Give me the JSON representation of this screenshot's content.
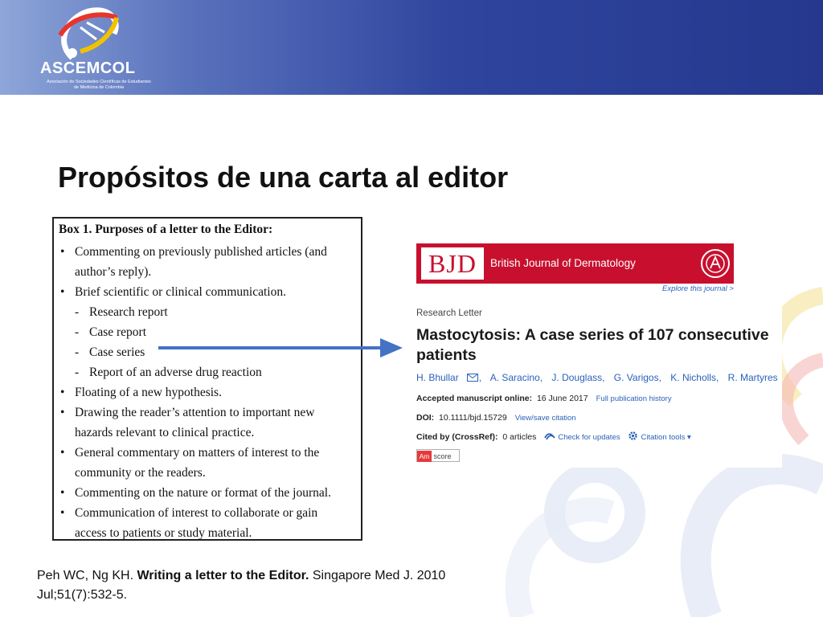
{
  "logo": {
    "name": "ASCEMCOL",
    "subtitle": "Asociación de Sociedades Científicas de Estudiantes de Medicina de Colombia",
    "icon": "dna-helix-logo"
  },
  "colors": {
    "header_start": "#8ea6d8",
    "header_end": "#25388e",
    "bjd_red": "#c8102e",
    "link_blue": "#2a62b8",
    "arrow_blue": "#4472c4"
  },
  "slide": {
    "title": "Propósitos de una carta al editor"
  },
  "box": {
    "title": "Box 1. Purposes of a letter to the Editor:",
    "rows": [
      {
        "marker": "•",
        "text": "Commenting on previously published articles (and",
        "sub": false
      },
      {
        "marker": "",
        "text": "author’s reply).",
        "sub": false
      },
      {
        "marker": "•",
        "text": "Brief scientific or clinical communication.",
        "sub": false
      },
      {
        "marker": "-",
        "text": "Research report",
        "sub": true
      },
      {
        "marker": "-",
        "text": "Case report",
        "sub": true
      },
      {
        "marker": "-",
        "text": "Case series",
        "sub": true
      },
      {
        "marker": "-",
        "text": "Report of an adverse drug reaction",
        "sub": true
      },
      {
        "marker": "•",
        "text": "Floating of a new hypothesis.",
        "sub": false
      },
      {
        "marker": "•",
        "text": "Drawing the reader’s attention to important new",
        "sub": false
      },
      {
        "marker": "",
        "text": "hazards relevant to clinical practice.",
        "sub": false
      },
      {
        "marker": "•",
        "text": "General commentary on matters of interest to the",
        "sub": false
      },
      {
        "marker": "",
        "text": "community or the readers.",
        "sub": false
      },
      {
        "marker": "•",
        "text": "Commenting on the nature or format of the journal.",
        "sub": false
      },
      {
        "marker": "•",
        "text": "Communication of interest to collaborate or gain",
        "sub": false
      },
      {
        "marker": "",
        "text": "access to patients or study material.",
        "sub": false
      }
    ]
  },
  "article": {
    "journal_abbr": "BJD",
    "journal_name": "British Journal of Dermatology",
    "explore_link": "Explore this journal >",
    "section": "Research Letter",
    "title": "Mastocytosis: A case series of 107 consecutive patients",
    "authors": [
      "H. Bhullar",
      "A. Saracino,",
      "J. Douglass,",
      "G. Varigos,",
      "K. Nicholls,",
      "R. Martyres"
    ],
    "accepted_label": "Accepted manuscript online:",
    "accepted_date": "16 June 2017",
    "history_link": "Full publication history",
    "doi_label": "DOI:",
    "doi_value": "10.1111/bjd.15729",
    "citation_link": "View/save citation",
    "cited_label": "Cited by (CrossRef):",
    "cited_value": "0 articles",
    "updates_link": "Check for updates",
    "tools_link": "Citation tools ▾",
    "altmetric_am": "Am",
    "altmetric_score": "score"
  },
  "reference": {
    "authors": "Peh WC, Ng KH. ",
    "title": "Writing a letter to the Editor.",
    "journal": " Singapore Med J. 2010 Jul;51(7):532-5."
  }
}
